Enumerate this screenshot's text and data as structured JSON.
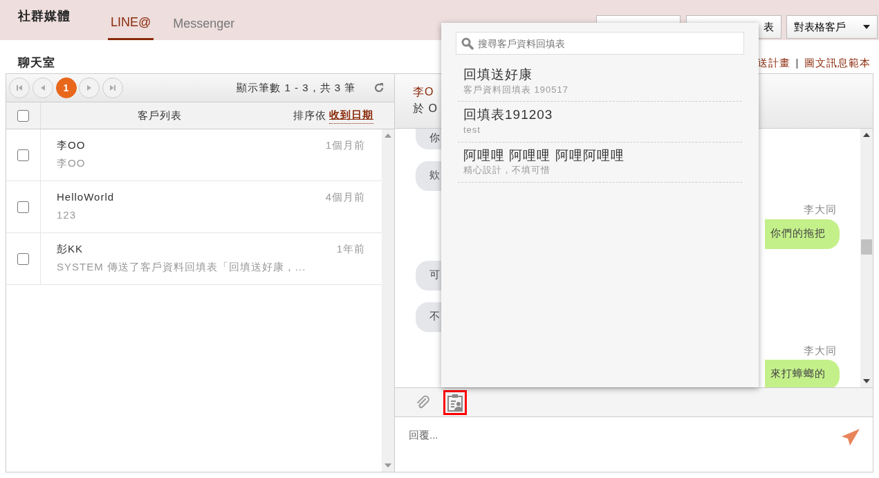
{
  "header": {
    "title": "社群媒體",
    "tabs": [
      {
        "label": "LINE@",
        "selected": true
      },
      {
        "label": "Messenger",
        "selected": false
      }
    ],
    "buttons": [
      {
        "kind": "plain"
      },
      {
        "kind": "plain",
        "label": "表"
      },
      {
        "kind": "dropdown",
        "label": "對表格客戶"
      }
    ]
  },
  "page": {
    "title": "聊天室",
    "links": [
      "送計畫",
      "圖文訊息範本"
    ],
    "separator": "|"
  },
  "customer_list": {
    "pager": {
      "pages": [
        {
          "label": "1",
          "selected": true
        }
      ],
      "summary": "顯示筆數 1 - 3，共 3 筆"
    },
    "all_checked": false,
    "column": "客戶列表",
    "sort_label": "排序依",
    "sort_value": "收到日期",
    "rows": [
      {
        "name": "李OO",
        "preview": "李OO",
        "time": "1個月前",
        "checked": false
      },
      {
        "name": "HelloWorld",
        "preview": "123",
        "time": "4個月前",
        "checked": false
      },
      {
        "name": "彭KK",
        "preview": "SYSTEM 傳送了客戶資料回填表「回填送好康，...",
        "time": "1年前",
        "checked": false
      }
    ]
  },
  "chat": {
    "header_name": "李O",
    "header_sub": "於 O",
    "messages": [
      {
        "kind": "incoming",
        "text": "你"
      },
      {
        "kind": "incoming",
        "text": "欸"
      },
      {
        "kind": "outgoing",
        "sender": "李大同",
        "text": "你們的拖把"
      },
      {
        "kind": "incoming",
        "text": "可"
      },
      {
        "kind": "incoming",
        "text": "不"
      },
      {
        "kind": "outgoing",
        "sender": "李大同",
        "text": "來打蟑螂的"
      }
    ],
    "tools": [
      {
        "kind": "attach",
        "selected": false
      },
      {
        "kind": "form",
        "selected": true
      }
    ],
    "reply": {
      "placeholder": "回覆..."
    }
  },
  "form_picker": {
    "search": {
      "placeholder": "搜尋客戶資料回填表"
    },
    "items": [
      {
        "title": "回填送好康",
        "subtitle": "客戶資料回填表 190517"
      },
      {
        "title": "回填表191203",
        "subtitle": "test"
      },
      {
        "title": "阿哩哩 阿哩哩 阿哩阿哩哩",
        "subtitle": "精心設計，不填可惜"
      }
    ]
  }
}
